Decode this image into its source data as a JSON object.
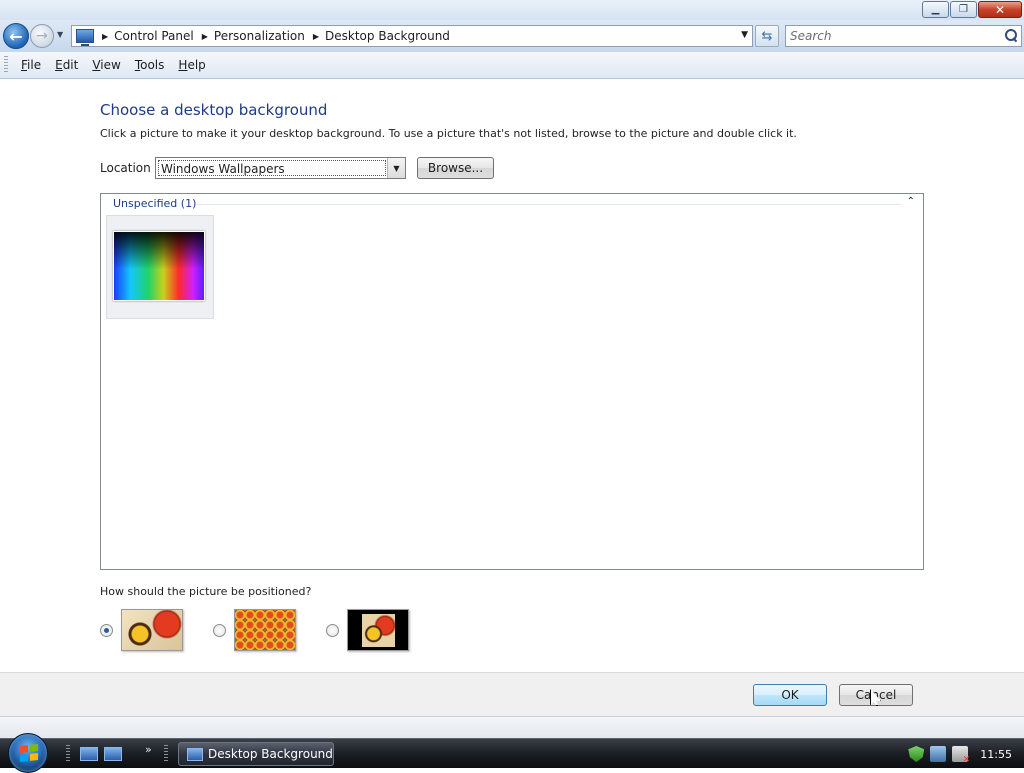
{
  "window": {
    "caption_buttons": {
      "minimize": "▁",
      "maximize": "❐",
      "close": "✕"
    }
  },
  "addressbar": {
    "back_glyph": "←",
    "forward_glyph": "→",
    "breadcrumbs": [
      "Control Panel",
      "Personalization",
      "Desktop Background"
    ],
    "search_placeholder": "Search"
  },
  "menu": {
    "items": [
      {
        "acc": "F",
        "rest": "ile"
      },
      {
        "acc": "E",
        "rest": "dit"
      },
      {
        "acc": "V",
        "rest": "iew"
      },
      {
        "acc": "T",
        "rest": "ools"
      },
      {
        "acc": "H",
        "rest": "elp"
      }
    ]
  },
  "main": {
    "title": "Choose a desktop background",
    "description": "Click a picture to make it your desktop background. To use a picture that's not listed, browse to the picture and double click it.",
    "location_label": "Location",
    "location_value": "Windows Wallpapers",
    "browse_label": "Browse...",
    "group_header": "Unspecified (1)",
    "collapse_glyph": "⌃",
    "position_question": "How should the picture be positioned?",
    "position_options": [
      {
        "name": "fit-to-screen",
        "checked": true
      },
      {
        "name": "tile",
        "checked": false
      },
      {
        "name": "center",
        "checked": false
      }
    ]
  },
  "footer": {
    "ok_label": "OK",
    "cancel_label": "Cancel"
  },
  "taskbar": {
    "more_glyph": "»",
    "task_label": "Desktop Background",
    "clock": "11:55"
  }
}
